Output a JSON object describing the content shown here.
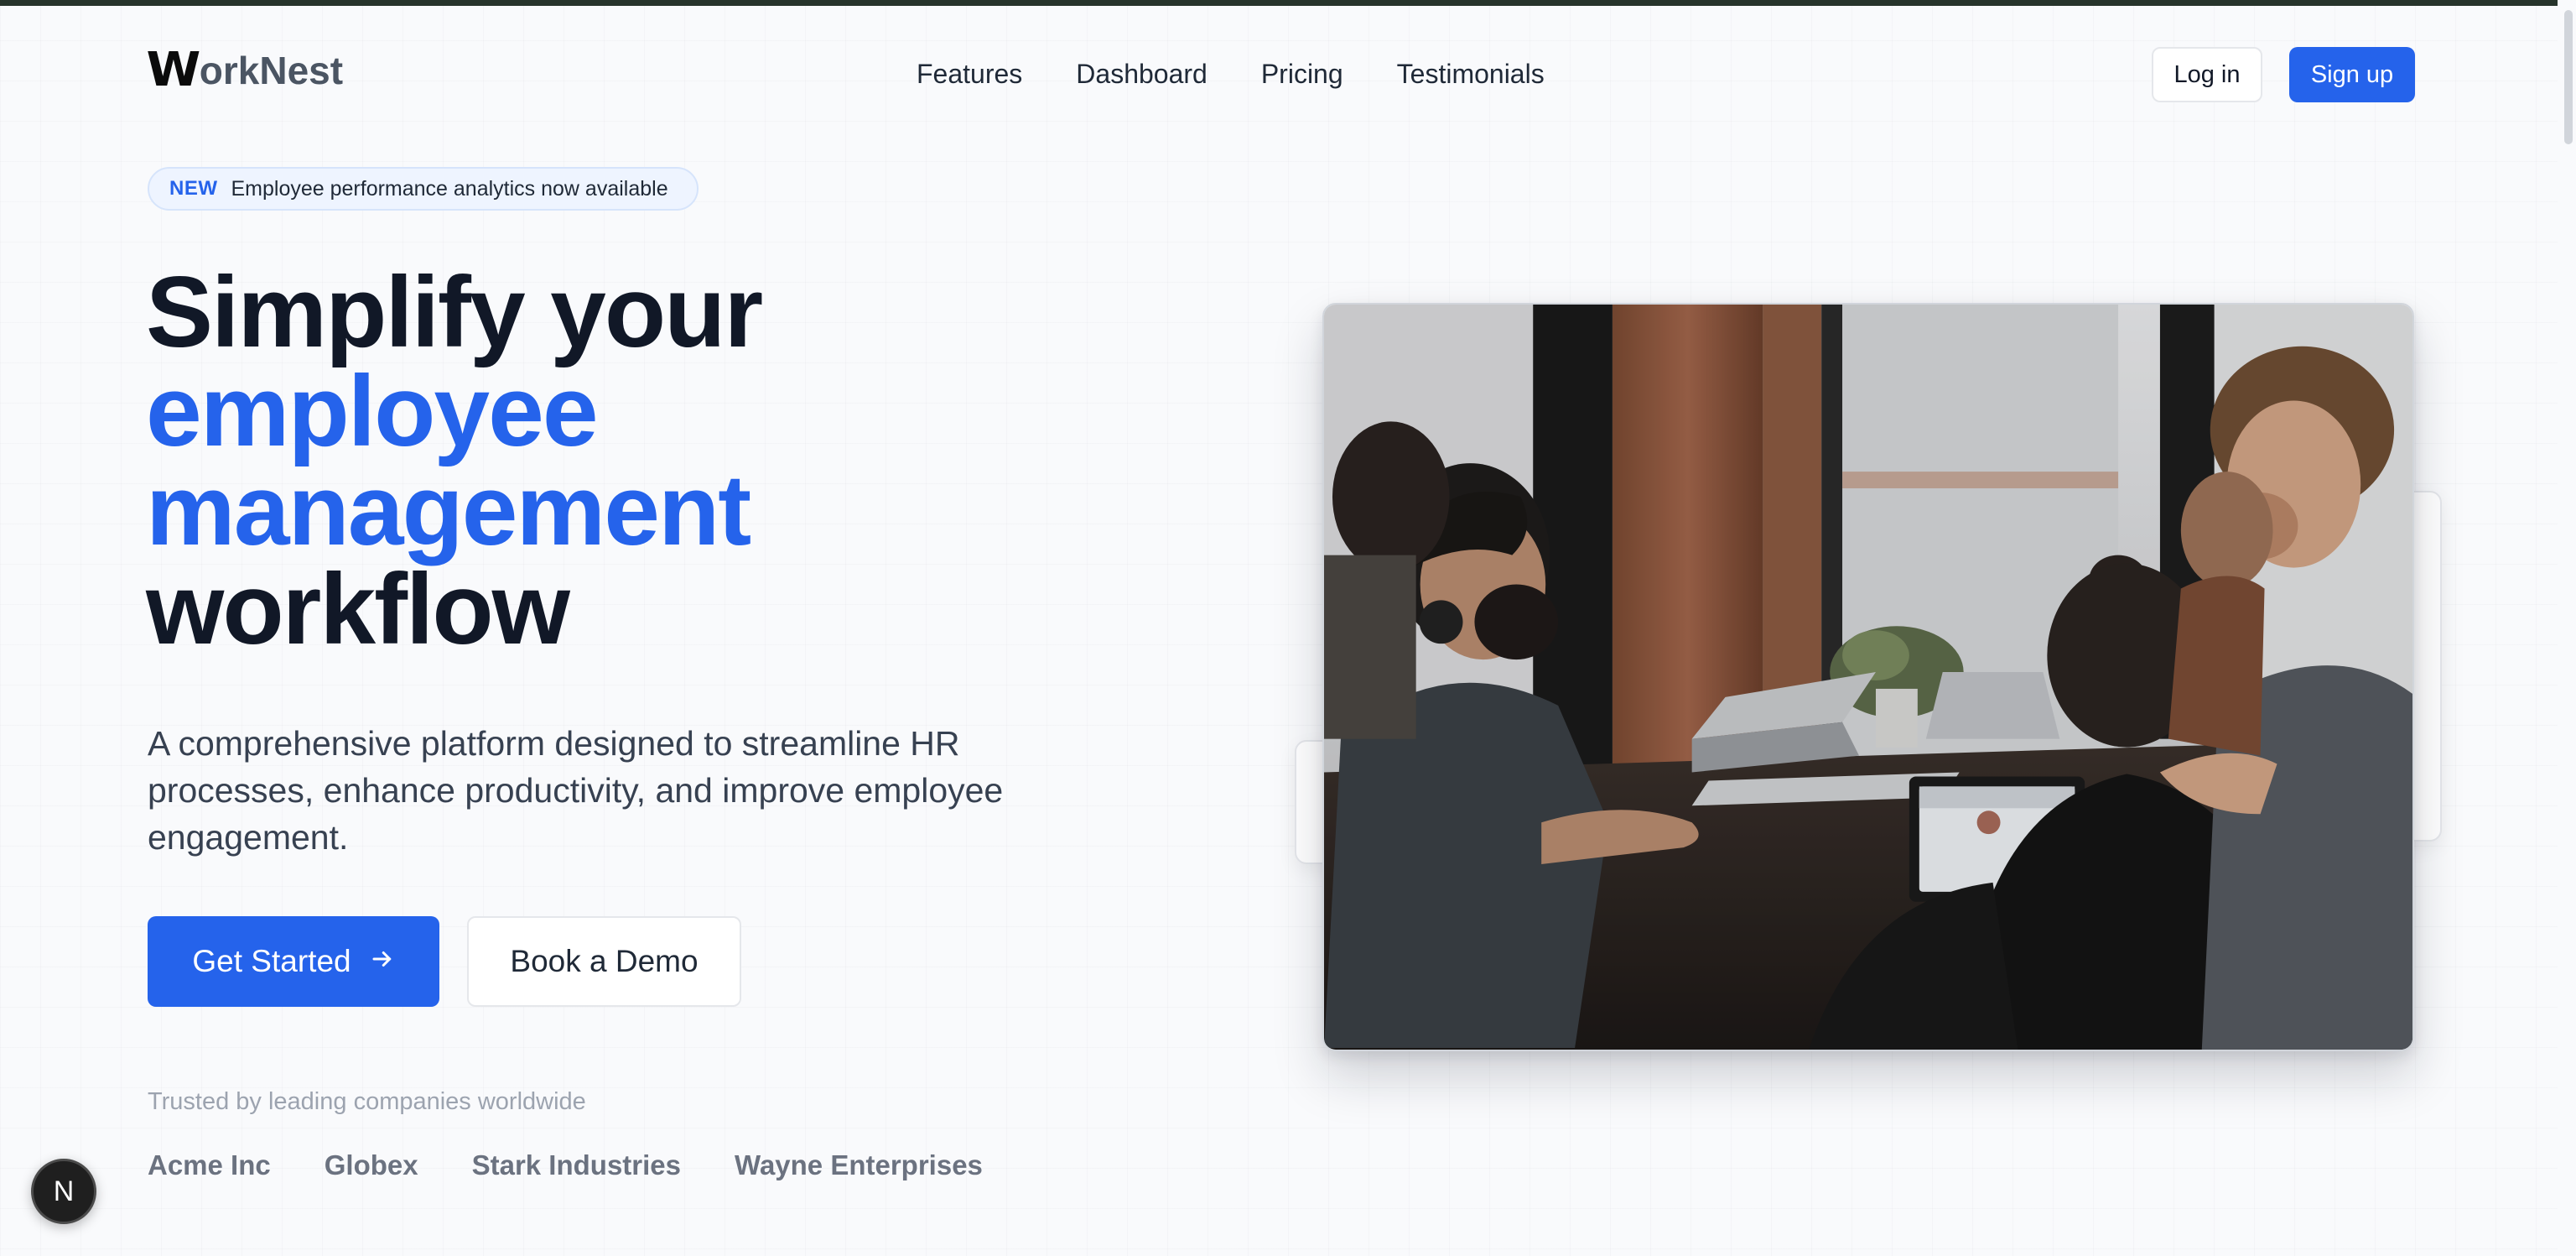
{
  "header": {
    "logo_first": "W",
    "logo_rest": "orkNest",
    "nav": [
      {
        "label": "Features"
      },
      {
        "label": "Dashboard"
      },
      {
        "label": "Pricing"
      },
      {
        "label": "Testimonials"
      }
    ],
    "login_label": "Log in",
    "signup_label": "Sign up"
  },
  "hero": {
    "badge_tag": "NEW",
    "badge_text": "Employee performance analytics now available",
    "headline": {
      "line1": "Simplify your",
      "line2": "employee",
      "line3": "management",
      "line4": "workflow"
    },
    "subtitle": "A comprehensive platform designed to streamline HR processes, enhance productivity, and improve employee engagement.",
    "cta_primary": "Get Started",
    "cta_primary_icon": "arrow-right-icon",
    "cta_secondary": "Book a Demo",
    "trusted_text": "Trusted by leading companies worldwide",
    "companies": [
      "Acme Inc",
      "Globex",
      "Stark Industries",
      "Wayne Enterprises"
    ]
  },
  "floating_button": {
    "label": "N"
  },
  "colors": {
    "accent": "#2563eb",
    "text_dark": "#111827",
    "muted": "#9ca3af"
  }
}
